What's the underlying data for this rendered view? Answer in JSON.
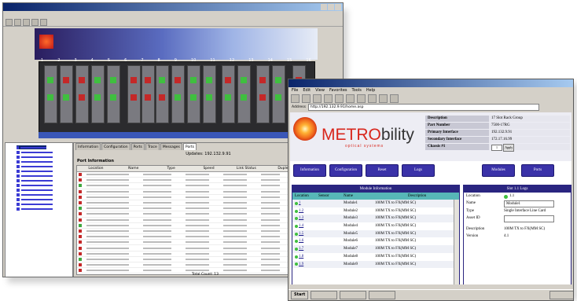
{
  "back_window": {
    "chassis_slot_numbers": [
      "1",
      "2",
      "3",
      "4",
      "5",
      "6",
      "7",
      "8",
      "9",
      "10",
      "11",
      "12",
      "13",
      "14",
      "15",
      "16"
    ],
    "tabs": [
      "Information",
      "Configuration",
      "Ports",
      "Trace",
      "Messages",
      "Ports"
    ],
    "panel_title": "Updates: 192.132.9.91",
    "section_label": "Port Information",
    "port_columns": [
      "Location",
      "Name",
      "Type",
      "Speed",
      "Link Status",
      "Duplex",
      "Traffic"
    ],
    "total_label": "Total Count: 13"
  },
  "front_window": {
    "menu": [
      "File",
      "Edit",
      "View",
      "Favorites",
      "Tools",
      "Help"
    ],
    "toolbar": [
      "Back",
      "Forward",
      "Stop",
      "Refresh",
      "Home",
      "Search",
      "Favorites",
      "History",
      "Mail",
      "Print"
    ],
    "address_label": "Address",
    "address_value": "http://192.132.9.91/home.asp",
    "logo": {
      "brand_main": "METRO",
      "brand_sub": "bility",
      "tagline": "optical systems"
    },
    "chassis_info": [
      {
        "label": "Description",
        "value": "17 Slot Rack Group"
      },
      {
        "label": "Part Number",
        "value": "7500-17RG"
      },
      {
        "label": "Primary Interface",
        "value": "192.132.9.91"
      },
      {
        "label": "Secondary Interface",
        "value": "172.17.16.99"
      },
      {
        "label": "Chassis #1",
        "value": ""
      }
    ],
    "chassis_select": "1",
    "apply_label": "Apply",
    "nav_buttons": [
      "Information",
      "Configuration",
      "Reset",
      "Logs",
      "Modules",
      "Ports"
    ],
    "module_panel": {
      "title": "Module Information",
      "columns": [
        "Location",
        "Sensor",
        "Name",
        "Description"
      ],
      "rows": [
        {
          "location": "1",
          "sensor": "",
          "name": "Module1",
          "description": "100M TX to FX(MM SC)"
        },
        {
          "location": "1.2",
          "sensor": "",
          "name": "Module2",
          "description": "100M TX to FX(MM SC)"
        },
        {
          "location": "1.3",
          "sensor": "",
          "name": "Module3",
          "description": "100M TX to FX(MM SC)"
        },
        {
          "location": "1.4",
          "sensor": "",
          "name": "Module4",
          "description": "100M TX to FX(MM SC)"
        },
        {
          "location": "1.5",
          "sensor": "",
          "name": "Module5",
          "description": "100M TX to FX(MM SC)"
        },
        {
          "location": "1.6",
          "sensor": "",
          "name": "Module6",
          "description": "100M TX to FX(MM SC)"
        },
        {
          "location": "1.7",
          "sensor": "",
          "name": "Module7",
          "description": "100M TX to FX(MM SC)"
        },
        {
          "location": "1.8",
          "sensor": "",
          "name": "Module8",
          "description": "100M TX to FX(MM SC)"
        },
        {
          "location": "1.9",
          "sensor": "",
          "name": "Module9",
          "description": "100M TX to FX(MM SC)"
        }
      ]
    },
    "slot_panel": {
      "title": "Slot 1.1 Logs",
      "location_label": "Location",
      "location_value": "1.1",
      "name_label": "Name",
      "name_value": "Module1",
      "type_label": "Type",
      "type_value": "Single Interface Line Card",
      "asset_label": "Asset ID",
      "asset_value": "",
      "description_label": "Description",
      "description_value": "100M TX to FX(MM SC)",
      "version_label": "Version",
      "version_value": "4.1"
    },
    "taskbar": {
      "start_label": "Start"
    }
  }
}
